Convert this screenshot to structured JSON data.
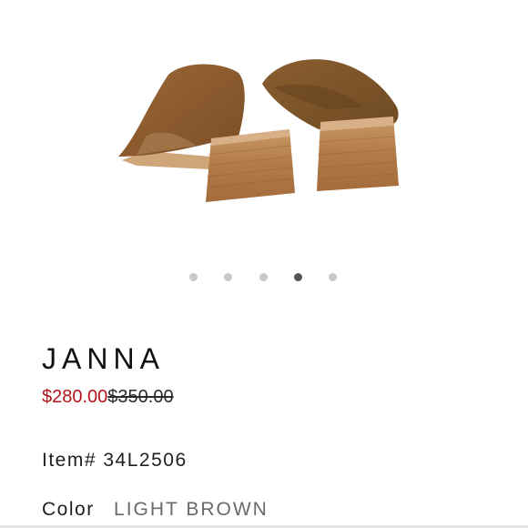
{
  "product": {
    "name": "JANNA",
    "sale_price": "$280.00",
    "original_price": "$350.00",
    "item_label": "Item#",
    "item_number": "34L2506",
    "color_label": "Color",
    "color_value": "LIGHT BROWN"
  },
  "gallery": {
    "image_description": "product photo: pair of light brown suede mules with stacked wooden block heels",
    "slide_count": 5,
    "active_slide_index": 3
  },
  "colors": {
    "sale_price": "#b3141c",
    "suede": "#8a5a2e",
    "heel_wood": "#b88452",
    "dot_inactive": "#c9c9c9",
    "dot_active": "#555555"
  }
}
